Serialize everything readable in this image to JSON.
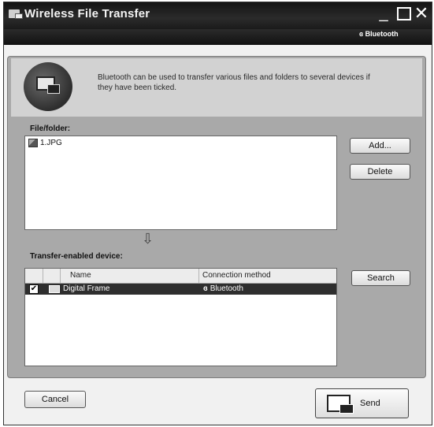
{
  "window": {
    "title": "Wireless File Transfer",
    "brand": "Bluetooth",
    "controls": {
      "minimize": "_",
      "close": "✕"
    }
  },
  "header": {
    "description": "Bluetooth can be used to transfer various files and folders to several devices if they have been ticked."
  },
  "files": {
    "label": "File/folder:",
    "items": [
      {
        "name": "1.JPG"
      }
    ],
    "add_label": "Add...",
    "delete_label": "Delete"
  },
  "devices": {
    "label": "Transfer-enabled device:",
    "columns": {
      "name": "Name",
      "connection": "Connection method"
    },
    "rows": [
      {
        "checked": true,
        "name": "Digital Frame",
        "method": "Bluetooth"
      }
    ],
    "search_label": "Search"
  },
  "footer": {
    "cancel_label": "Cancel",
    "send_label": "Send"
  },
  "icons": {
    "arrow": "⇩",
    "check": "✔",
    "bluetooth": "ɞ"
  }
}
